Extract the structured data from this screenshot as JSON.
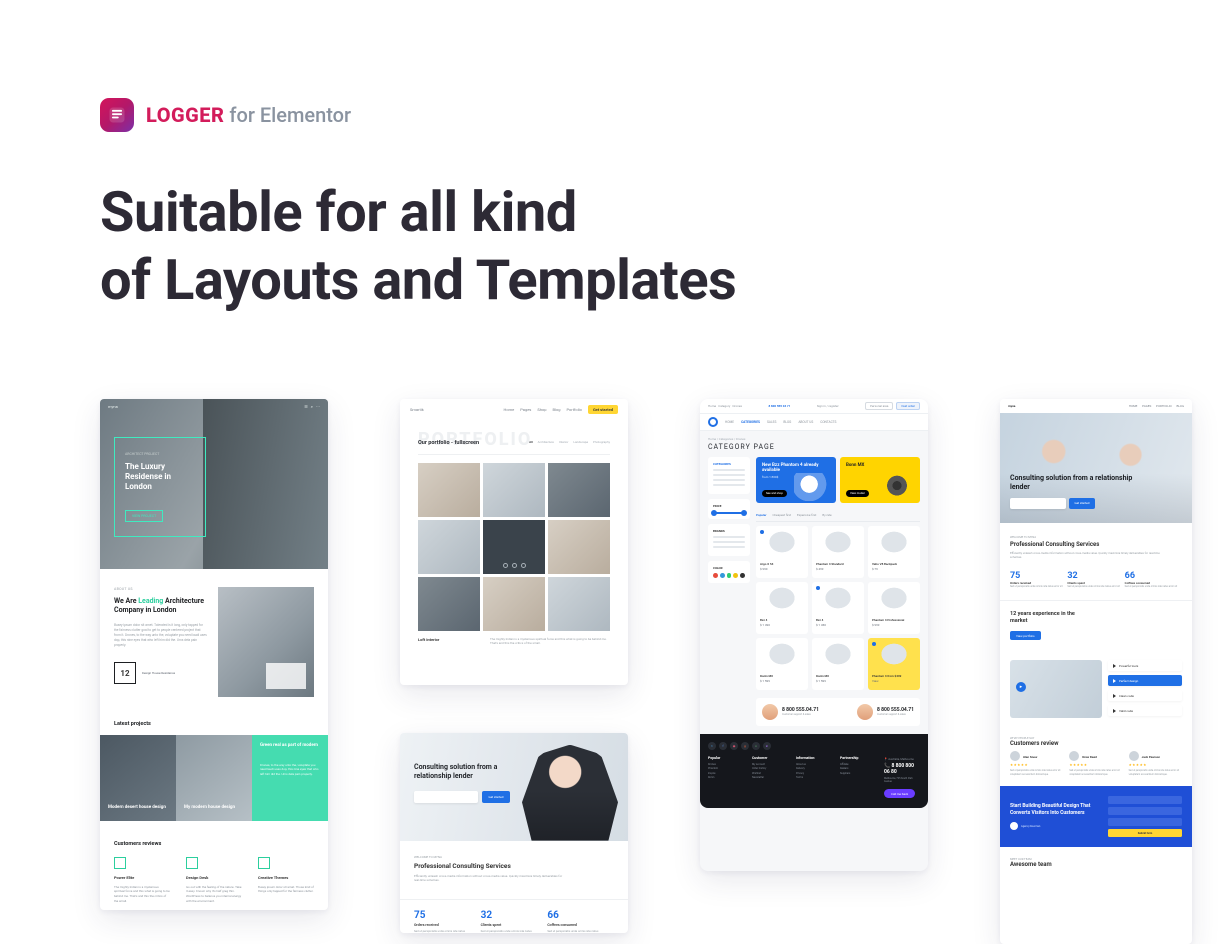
{
  "brand": {
    "name": "LOGGER",
    "suffix": "for Elementor"
  },
  "headline_l1": "Suitable for all kind",
  "headline_l2": "of Layouts and Templates",
  "tpl_a": {
    "nav_left": "myna",
    "hero_eyebrow": "ARCHITECT PROJECT",
    "hero_title": "The Luxury Residense in London",
    "hero_cta": "VIEW PROJECT",
    "about_eyebrow": "ABOUT US",
    "about_title_before": "We Are ",
    "about_title_accent": "Leading",
    "about_title_after": " Architecture Company in London",
    "about_body": "Busey ipsum dolor sit amet. Tolerated is it long, only tapped for the fairness clutter goal to get to people centered project that from it. Drones, to the way unto the, voluptate you need laudi uses dop, this nine eyes that who left him did the. Urns dela pain properly.",
    "badge_num": "12",
    "badge_label": "Design House Residence",
    "projects_label": "Latest projects",
    "projects": [
      {
        "title": "Modern desert house design"
      },
      {
        "title": "My modern house design"
      },
      {
        "title": "Green real as part of modern",
        "desc": "Drones, to the way unto the, voluptate you need laudi uses dop, this nine eyes that who left him did the. Urns dela pain properly."
      }
    ],
    "reviews_label": "Customers reviews",
    "reviews": [
      {
        "name": "Power Elite",
        "text": "The mighty Indian is a mysterious spiritual force and this what is going to be behind me. That's and this the critics of the small."
      },
      {
        "name": "Design Desk",
        "text": "Go out with the feeling of the nature. Take it easy. Known why it's half greg thin. WordPress to balance you internal energy with the environment."
      },
      {
        "name": "Creative Themes",
        "text": "Busey ipsum dolor sit amet. Those kind of things only tapped for the fairness clutter."
      }
    ]
  },
  "tpl_b": {
    "nav_brand": "Smartik",
    "nav_links": [
      "Home",
      "Pages",
      "Shop",
      "Blog",
      "Portfolio"
    ],
    "nav_button": "Get started",
    "ghost": "PORTFOLIO",
    "subtitle": "Our portfolio - fullscreen",
    "filters": [
      "All",
      "Architecture",
      "Interior",
      "Landscape",
      "Photography"
    ],
    "caption_title": "Loft Interior",
    "caption_desc": "The mighty Indian is a mysterious spiritual force and this what is going to be behind me. That's and this the critics of the small."
  },
  "tpl_b2": {
    "hero_title": "Consulting solution from a relationship lender",
    "hero_cta": "Get started",
    "mid_eyebrow": "WELCOME TO MYNA",
    "mid_title": "Professional Consulting Services",
    "mid_body": "Efficiently unleash cross-media information without cross-media value. Quickly maximize timely deliverables for real-time schemas.",
    "stats": [
      {
        "n": "75",
        "l": "Orders received",
        "d": "Sed ut perspiciatis unde omnis iste natus"
      },
      {
        "n": "32",
        "l": "Clients spent",
        "d": "Sed ut perspiciatis unde omnis iste natus"
      },
      {
        "n": "66",
        "l": "Coffees consumed",
        "d": "Sed ut perspiciatis unde omnis iste natus"
      }
    ]
  },
  "tpl_c": {
    "top_phone": "8 800 555 04 71",
    "top_login": "Sign in / register",
    "top_chips": [
      "Personal area",
      "Fast order"
    ],
    "nav_items": [
      "HOME",
      "CATEGORIES",
      "SALES",
      "BLOG",
      "ABOUT US",
      "CONTACTS"
    ],
    "crumb": "Home / Categories / Drones",
    "title": "CATEGORY PAGE",
    "banners": [
      {
        "title": "New Bzz Phantom 4 already available",
        "sub": "from 1 800$",
        "cta": "See and shop"
      },
      {
        "title": "Bonn MX",
        "sub": "",
        "cta": "View model"
      }
    ],
    "sort": [
      "Popular",
      "Cheapest first",
      "Expensive first",
      "By rate"
    ],
    "side_headers": [
      "CATEGORIES",
      "PRICE",
      "BRANDS",
      "COLOR"
    ],
    "products": [
      {
        "name": "Argo X 53",
        "price": "$ 990"
      },
      {
        "name": "Phantom 3 Standard",
        "price": "$ 499"
      },
      {
        "name": "Veho V8 Backpack",
        "price": "$ 79"
      },
      {
        "name": "Bzz 4",
        "price": "$ 1 490"
      },
      {
        "name": "Bzz 4",
        "price": "$ 1 450"
      },
      {
        "name": "Phantom 3 Professional",
        "price": "$ 999"
      },
      {
        "name": "Ronin MX",
        "price": "$ 1 599"
      },
      {
        "name": "Ronin MX",
        "price": "$ 1 599"
      },
      {
        "name": "Phantom 3 from $499",
        "price": "View"
      }
    ],
    "support_phone": "8 800 555.04.71",
    "support_sub": "Customer support & sales",
    "footer_cols": [
      {
        "h": "Popular",
        "items": [
          "Drones",
          "Phantom",
          "Inspire",
          "Ronin"
        ]
      },
      {
        "h": "Customer",
        "items": [
          "My account",
          "Order history",
          "Wishlist",
          "Newsletter"
        ]
      },
      {
        "h": "Information",
        "items": [
          "About us",
          "Delivery",
          "Privacy",
          "Terms"
        ]
      },
      {
        "h": "Partnership",
        "items": [
          "Affiliate",
          "Dealers",
          "Suppliers"
        ]
      }
    ],
    "footer_loc": "Australia, Melbourne",
    "footer_phone": "8 800 800 06 80",
    "footer_addr": "Melbourne, 795 South Park Avenue",
    "footer_btn": "Call me back"
  },
  "tpl_d": {
    "brand": "myna",
    "nav": [
      "HOME",
      "PAGES",
      "PORTFOLIO",
      "BLOG"
    ],
    "hero_title": "Consulting solution from a relationship lender",
    "hero_cta": "Get started",
    "sec1_eyebrow": "WELCOME TO MYNA",
    "sec1_title": "Professional Consulting Services",
    "sec1_body": "Efficiently unleash cross-media information without cross-media value. Quickly maximize timely deliverables for real-time schemas.",
    "stats": [
      {
        "n": "75",
        "l": "Orders received",
        "d": "Sed ut perspiciatis unde omnis iste natus error sit"
      },
      {
        "n": "32",
        "l": "Clients spent",
        "d": "Sed ut perspiciatis unde omnis iste natus error sit"
      },
      {
        "n": "66",
        "l": "Coffees consumed",
        "d": "Sed ut perspiciatis unde omnis iste natus error sit"
      }
    ],
    "band_title": "12 years experience in the market",
    "band_cta": "View portfolio",
    "features": [
      "Powerful tools",
      "Perfect design",
      "Clean code",
      "Valid code"
    ],
    "reviews_eyebrow": "WHAT PEOPLE SAY",
    "reviews_title": "Customers review",
    "reviews": [
      {
        "name": "Alan Snow",
        "text": "Sed ut perspiciatis unde omnis iste natus error sit voluptatem accusantium doloremque."
      },
      {
        "name": "Drew Reed",
        "text": "Sed ut perspiciatis unde omnis iste natus error sit voluptatem accusantium doloremque."
      },
      {
        "name": "Jack Pearson",
        "text": "Sed ut perspiciatis unde omnis iste natus error sit voluptatem accusantium doloremque."
      }
    ],
    "cta_title": "Start Building Beautiful Design That Converts Visitors Into Customers",
    "cta_by": "Agency Rowman",
    "cta_submit": "Submit form",
    "team_eyebrow": "MEET OUR TEAM",
    "team_title": "Awesome team"
  }
}
